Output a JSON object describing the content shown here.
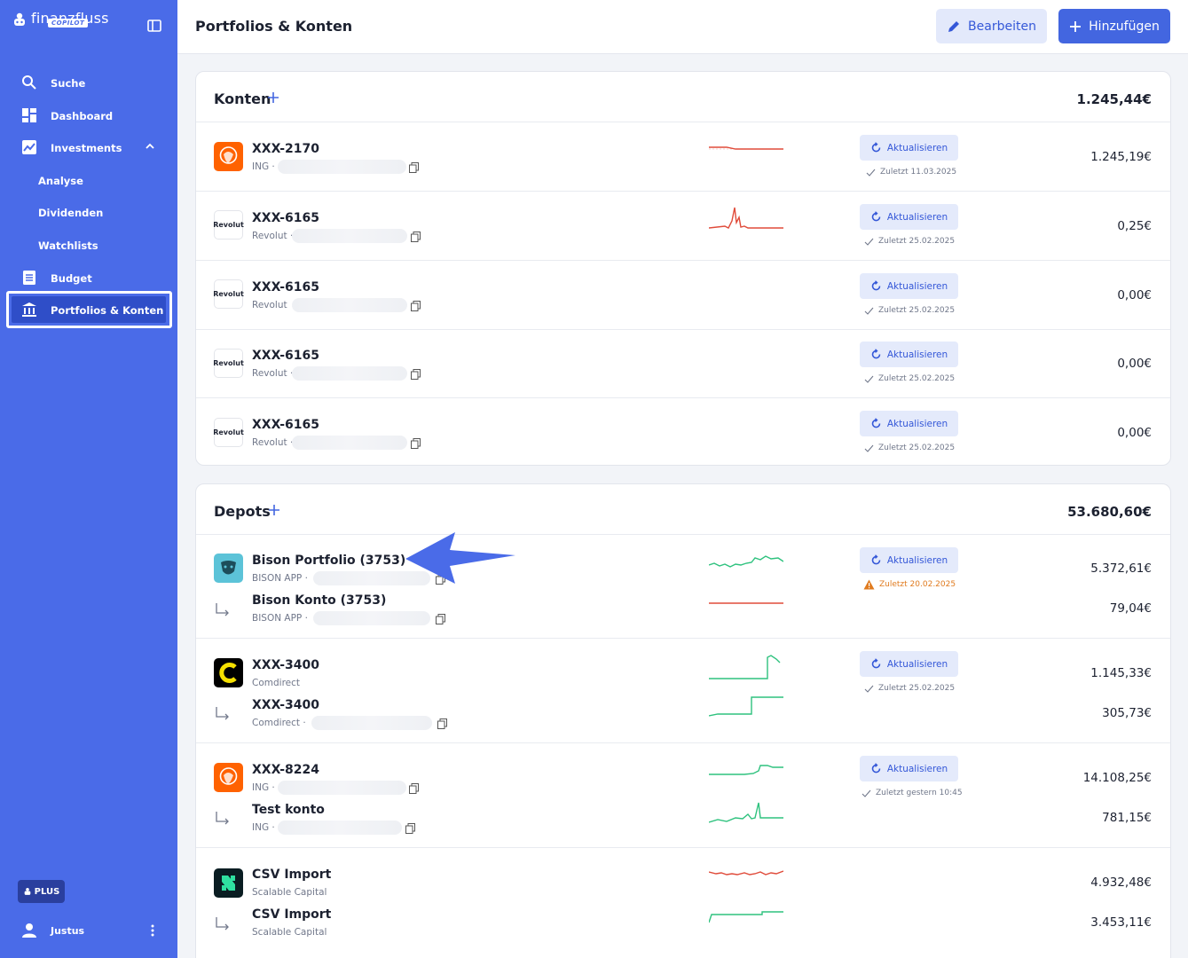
{
  "app": {
    "logo_text": "finanzfluss",
    "logo_badge": "COPILOT"
  },
  "sidebar": {
    "items": [
      {
        "label": "Suche"
      },
      {
        "label": "Dashboard"
      },
      {
        "label": "Investments"
      },
      {
        "label": "Analyse"
      },
      {
        "label": "Dividenden"
      },
      {
        "label": "Watchlists"
      },
      {
        "label": "Budget"
      },
      {
        "label": "Portfolios & Konten"
      }
    ],
    "plan_badge": "PLUS",
    "user_name": "Justus"
  },
  "header": {
    "title": "Portfolios & Konten",
    "edit_label": "Bearbeiten",
    "add_label": "Hinzufügen"
  },
  "konten": {
    "title": "Konten",
    "total": "1.245,44€",
    "rows": [
      {
        "name": "XXX-2170",
        "bank": "ING",
        "updated": "Zuletzt 11.03.2025",
        "amount": "1.245,19€",
        "refresh": "Aktualisieren"
      },
      {
        "name": "XXX-6165",
        "bank": "Revolut",
        "updated": "Zuletzt 25.02.2025",
        "amount": "0,25€",
        "refresh": "Aktualisieren"
      },
      {
        "name": "XXX-6165",
        "bank": "Revolut",
        "updated": "Zuletzt 25.02.2025",
        "amount": "0,00€",
        "refresh": "Aktualisieren"
      },
      {
        "name": "XXX-6165",
        "bank": "Revolut",
        "updated": "Zuletzt 25.02.2025",
        "amount": "0,00€",
        "refresh": "Aktualisieren"
      },
      {
        "name": "XXX-6165",
        "bank": "Revolut",
        "updated": "Zuletzt 25.02.2025",
        "amount": "0,00€",
        "refresh": "Aktualisieren"
      }
    ],
    "revolut_logo_text": "Revolut"
  },
  "depots": {
    "title": "Depots",
    "total": "53.680,60€",
    "rows": [
      {
        "name": "Bison Portfolio (3753)",
        "bank": "BISON APP",
        "sub_name": "Bison Konto (3753)",
        "sub_bank": "BISON APP",
        "updated": "Zuletzt 20.02.2025",
        "amount": "5.372,61€",
        "sub_amount": "79,04€",
        "refresh": "Aktualisieren"
      },
      {
        "name": "XXX-3400",
        "bank": "Comdirect",
        "sub_name": "XXX-3400",
        "sub_bank": "Comdirect",
        "updated": "Zuletzt 25.02.2025",
        "amount": "1.145,33€",
        "sub_amount": "305,73€",
        "refresh": "Aktualisieren"
      },
      {
        "name": "XXX-8224",
        "bank": "ING",
        "sub_name": "Test konto",
        "sub_bank": "ING",
        "updated": "Zuletzt gestern 10:45",
        "amount": "14.108,25€",
        "sub_amount": "781,15€",
        "refresh": "Aktualisieren"
      },
      {
        "name": "CSV Import",
        "bank": "Scalable Capital",
        "sub_name": "CSV Import",
        "sub_bank": "Scalable Capital",
        "amount": "4.932,48€",
        "sub_amount": "3.453,11€"
      }
    ]
  },
  "colors": {
    "sidebar": "#4a6be8",
    "primary": "#4366e0",
    "positive": "#2ec27e",
    "negative": "#e04b3a",
    "warning": "#e07b1f"
  }
}
